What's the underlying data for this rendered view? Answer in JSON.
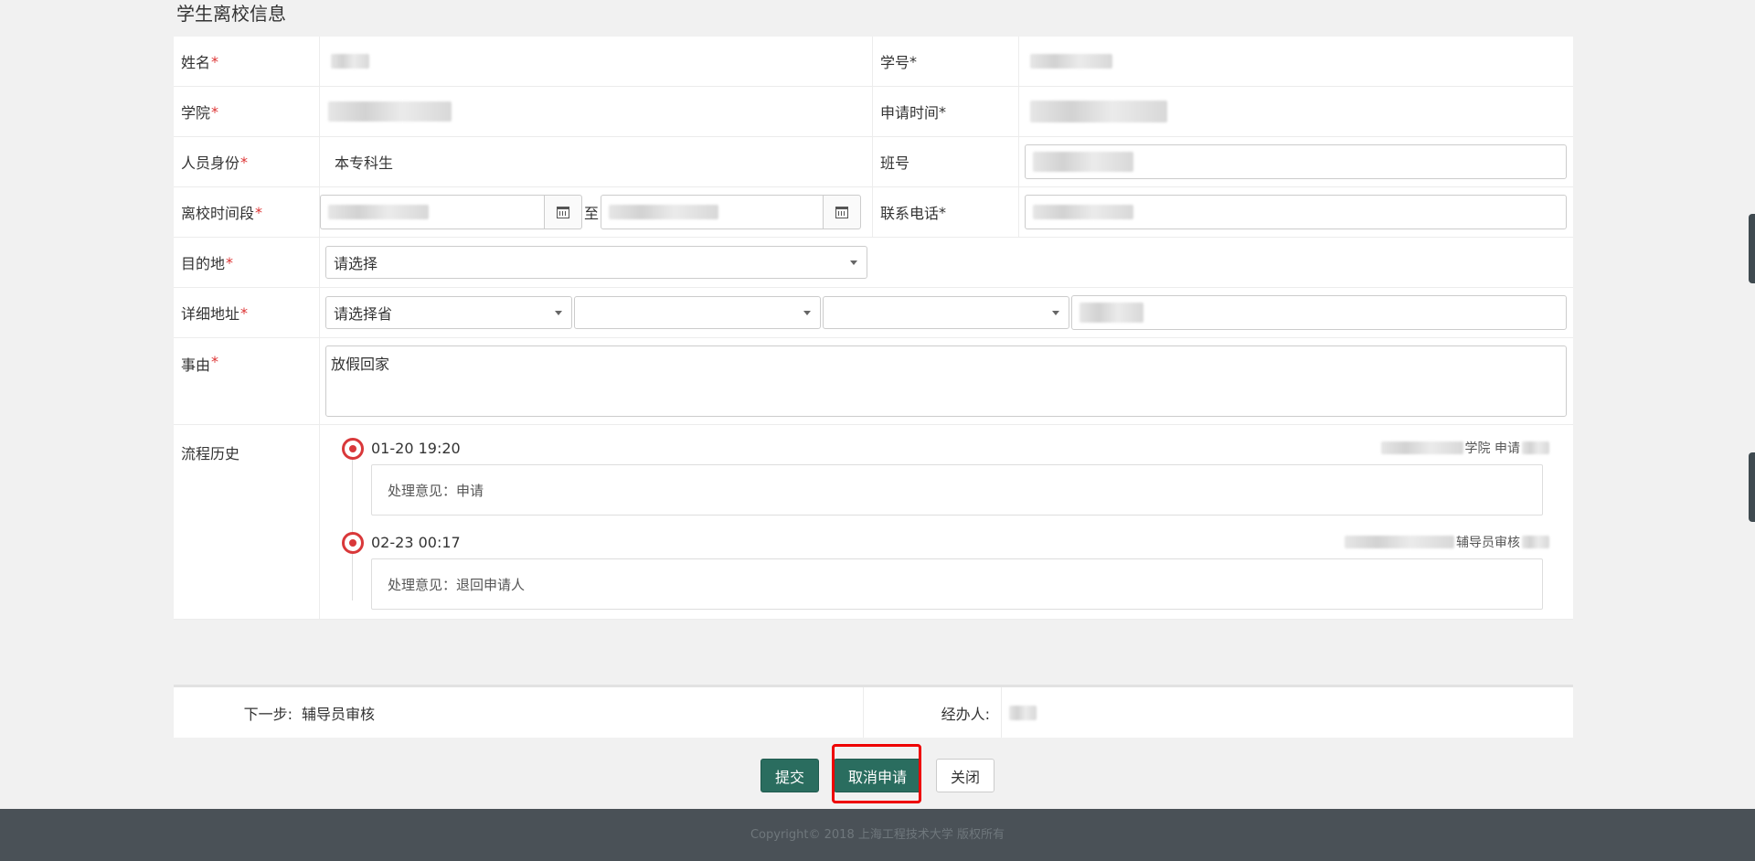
{
  "section_title": "学生离校信息",
  "form": {
    "name_label": "姓名",
    "student_id_label": "学号",
    "college_label": "学院",
    "apply_time_label": "申请时间",
    "identity_label": "人员身份",
    "identity_value": "本专科生",
    "class_label": "班号",
    "leave_period_label": "离校时间段",
    "to_text": "至",
    "phone_label": "联系电话",
    "destination_label": "目的地",
    "destination_placeholder": "请选择",
    "address_label": "详细地址",
    "province_placeholder": "请选择省",
    "reason_label": "事由",
    "reason_value": "放假回家",
    "history_label": "流程历史",
    "required_mark": "*"
  },
  "history": [
    {
      "time": "01-20 19:20",
      "who_suffix": "学院 申请",
      "opinion": "处理意见：申请"
    },
    {
      "time": "02-23 00:17",
      "who_suffix": "辅导员审核",
      "opinion": "处理意见：退回申请人"
    }
  ],
  "next_step": {
    "label": "下一步:",
    "value": "辅导员审核",
    "handler_label": "经办人:"
  },
  "buttons": {
    "submit": "提交",
    "cancel_apply": "取消申请",
    "close": "关闭"
  },
  "copyright": "Copyright© 2018 上海工程技术大学 版权所有",
  "colors": {
    "primary": "#2a6d5f",
    "required": "#dd3333",
    "timeline_dot": "#d9383a",
    "highlight": "#ee0000",
    "footer_bg": "#4a5157"
  }
}
